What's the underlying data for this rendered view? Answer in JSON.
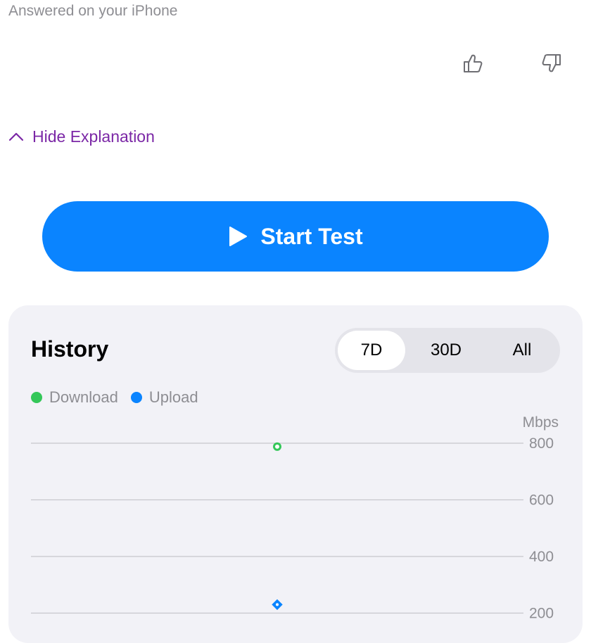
{
  "answered_text": "Answered on your iPhone",
  "feedback": {
    "like_icon": "thumbs-up-icon",
    "dislike_icon": "thumbs-down-icon"
  },
  "hide_explanation": {
    "label": "Hide Explanation",
    "icon": "chevron-up-icon",
    "color": "#7b27a6"
  },
  "start_button": {
    "label": "Start Test",
    "icon": "play-icon",
    "color": "#0a84ff"
  },
  "history": {
    "title": "History",
    "ranges": [
      "7D",
      "30D",
      "All"
    ],
    "selected_range": "7D",
    "legend": [
      {
        "label": "Download",
        "color": "#34c759"
      },
      {
        "label": "Upload",
        "color": "#0a84ff"
      }
    ],
    "unit": "Mbps"
  },
  "chart_data": {
    "type": "scatter",
    "ylabel": "Mbps",
    "y_ticks": [
      "800",
      "600",
      "400",
      "200"
    ],
    "ylim": [
      0,
      800
    ],
    "series": [
      {
        "name": "Download",
        "values": [
          788
        ],
        "color": "#34c759",
        "marker": "circle"
      },
      {
        "name": "Upload",
        "values": [
          230
        ],
        "color": "#0a84ff",
        "marker": "diamond"
      }
    ],
    "grid": true
  }
}
